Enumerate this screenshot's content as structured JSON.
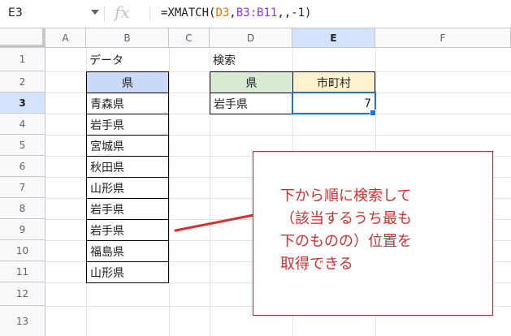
{
  "formula_bar": {
    "cell_ref": "E3",
    "fx_label": "fx",
    "formula_prefix": "=XMATCH(",
    "ref1": "D3",
    "comma1": ",",
    "ref2": "B3:B11",
    "formula_suffix": ",,-1)"
  },
  "columns": [
    "A",
    "B",
    "C",
    "D",
    "E",
    "F"
  ],
  "rows": [
    "1",
    "2",
    "3",
    "4",
    "5",
    "6",
    "7",
    "8",
    "9",
    "10",
    "11",
    "12",
    "13"
  ],
  "cells": {
    "b1": "データ",
    "b2": "県",
    "b_list": [
      "青森県",
      "岩手県",
      "宮城県",
      "秋田県",
      "山形県",
      "岩手県",
      "岩手県",
      "福島県",
      "山形県"
    ],
    "d1": "検索",
    "d2": "県",
    "e2": "市町村",
    "d3": "岩手県",
    "e3": "7"
  },
  "callout": {
    "lines": [
      "下から順に検索して",
      "（該当するうち最も",
      "下のものの）位置を",
      "取得できる"
    ]
  },
  "colors": {
    "header_blue": "#c9daf8",
    "header_green": "#d9ead3",
    "header_yellow": "#fff2cc",
    "selection": "#1a73e8",
    "annotation_red": "#d32f2f"
  }
}
